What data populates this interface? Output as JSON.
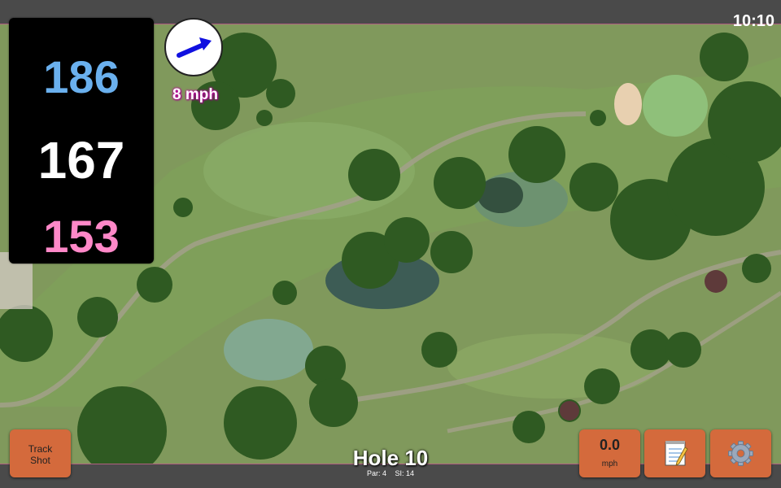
{
  "status": {
    "time": "10:10"
  },
  "distances": {
    "back": "186",
    "middle": "167",
    "front": "153"
  },
  "wind": {
    "speed_label": "8 mph"
  },
  "buttons": {
    "track_shot_line1": "Track",
    "track_shot_line2": "Shot",
    "speed_value": "0.0",
    "speed_unit": "mph",
    "notes_icon": "notepad-icon",
    "settings_icon": "gear-icon"
  },
  "hole": {
    "title": "Hole 10",
    "par": "Par: 4",
    "si": "SI: 14"
  },
  "colors": {
    "back": "#6ab0ee",
    "middle": "#ffffff",
    "front": "#ff88c8",
    "button": "#d46a3c",
    "bar": "#4a4a4a",
    "wind_arrow": "#1010e0"
  }
}
